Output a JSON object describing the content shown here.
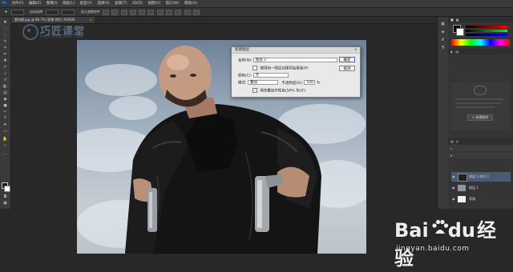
{
  "menubar": {
    "app_badge": "Ps",
    "items": [
      "文件(F)",
      "编辑(E)",
      "图像(I)",
      "图层(L)",
      "类型(Y)",
      "选择(S)",
      "滤镜(T)",
      "3D(D)",
      "视图(V)",
      "窗口(W)",
      "帮助(H)"
    ]
  },
  "optionsbar": {
    "auto_select": "自动选择",
    "transform": "显示变换控件"
  },
  "document_tab": {
    "title": "素材图.jpg @ 66.7% (背景 拷贝, RGB/8)",
    "close_glyph": "×"
  },
  "top_watermark": {
    "name": "巧匠课堂",
    "sub": "WWW.QIAOJIANG.COM"
  },
  "dialog": {
    "title": "新建图层",
    "close_glyph": "x",
    "name_label": "名称(N):",
    "name_value": "图层 2",
    "clip_label": "使用前一图层创建剪贴蒙版(P)",
    "color_label": "颜色(C):",
    "color_value": "无",
    "mode_label": "模式:",
    "mode_value": "叠加",
    "opacity_label": "不透明度(O):",
    "opacity_value": "100",
    "opacity_unit": "%",
    "fill_label": "填充叠加中性色(50% 灰)(F)",
    "fill_check": "✓",
    "ok_label": "确定",
    "cancel_label": "取消"
  },
  "right_panel": {
    "cc_button": "+ 创建图库",
    "layers": [
      {
        "name": "图层 1 拷贝 2",
        "selected": true
      },
      {
        "name": "图层 1",
        "selected": false
      },
      {
        "name": "背景",
        "selected": false
      }
    ]
  },
  "baidu_watermark": {
    "brand": "Bai",
    "brand2": "du",
    "product": "经验",
    "url": "jingyan.baidu.com"
  },
  "colors": {
    "accent": "#31a8ff",
    "dialog_bg": "#e9e9e9",
    "layer_selected": "#4b5a74",
    "ok_highlight": "#fff03c"
  }
}
